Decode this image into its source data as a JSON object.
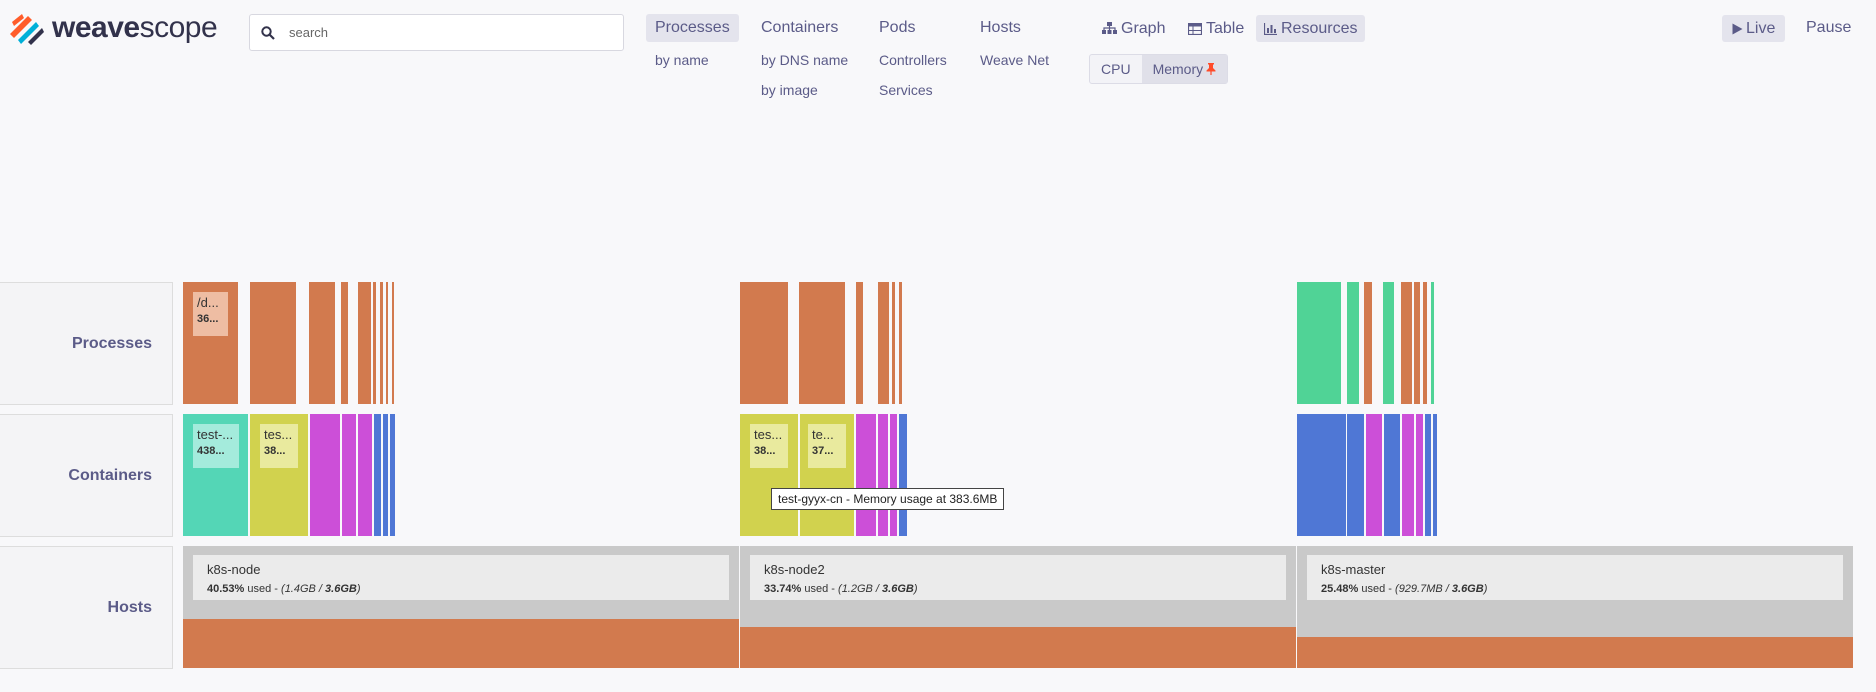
{
  "app": {
    "logo_text_bold": "weave",
    "logo_text_light": "scope",
    "search_placeholder": "search"
  },
  "topologies": {
    "processes": {
      "label": "Processes",
      "subs": [
        "by name"
      ]
    },
    "containers": {
      "label": "Containers",
      "subs": [
        "by DNS name",
        "by image"
      ]
    },
    "pods": {
      "label": "Pods",
      "subs": [
        "Controllers",
        "Services"
      ]
    },
    "hosts": {
      "label": "Hosts",
      "subs": [
        "Weave Net"
      ]
    }
  },
  "views": {
    "graph": "Graph",
    "table": "Table",
    "resources": "Resources"
  },
  "metrics": {
    "cpu": "CPU",
    "memory": "Memory"
  },
  "controls": {
    "live": "Live",
    "pause": "Pause"
  },
  "layers": {
    "processes": "Processes",
    "containers": "Containers",
    "hosts": "Hosts"
  },
  "cards": {
    "proc1_name": "/d...",
    "proc1_value": "36...",
    "c1_name": "test-...",
    "c1_value": "438...",
    "c2_name": "tes...",
    "c2_value": "38...",
    "c3_name": "tes...",
    "c3_value": "38...",
    "c4_name": "te...",
    "c4_value": "37..."
  },
  "hosts": [
    {
      "name": "k8s-node",
      "percent": "40.53%",
      "used_label": "used",
      "used": "1.4GB",
      "total": "3.6GB"
    },
    {
      "name": "k8s-node2",
      "percent": "33.74%",
      "used_label": "used",
      "used": "1.2GB",
      "total": "3.6GB"
    },
    {
      "name": "k8s-master",
      "percent": "25.48%",
      "used_label": "used",
      "used": "929.7MB",
      "total": "3.6GB"
    }
  ],
  "tooltip": "test-gyyx-cn - Memory usage at 383.6MB",
  "colors": {
    "process": "#d27a4e",
    "process_alt": "#50d396",
    "container_teal": "#54d6b6",
    "container_yellow": "#d1d24e",
    "container_magenta": "#cc4fd8",
    "container_blue": "#4f77d5",
    "host_background": "#c9c9c9"
  }
}
